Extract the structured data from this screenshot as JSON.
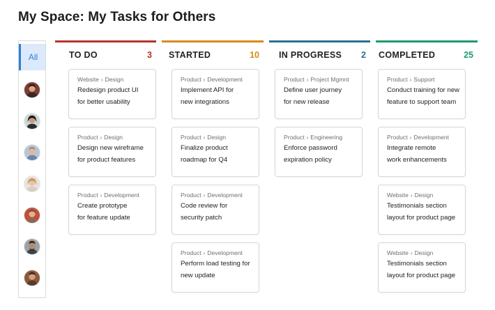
{
  "page_title": "My Space: My Tasks for Others",
  "filter": {
    "all_label": "All"
  },
  "colors": {
    "todo": "#b8322a",
    "started": "#d98a1c",
    "in_progress": "#2a6f92",
    "completed": "#1f9a6b",
    "accent": "#2f80d7"
  },
  "avatars": [
    "person-1-avatar",
    "person-2-avatar",
    "person-3-avatar",
    "person-4-avatar",
    "person-5-avatar",
    "person-6-avatar",
    "person-7-avatar"
  ],
  "columns": [
    {
      "title": "TO DO",
      "count": "3",
      "cards": [
        {
          "category": "Website",
          "subcategory": "Design",
          "line1": "Redesign product UI",
          "line2": "for better usability"
        },
        {
          "category": "Product",
          "subcategory": "Design",
          "line1": "Design new wireframe",
          "line2": "for product features"
        },
        {
          "category": "Product",
          "subcategory": "Development",
          "line1": "Create prototype",
          "line2": "for feature update"
        }
      ]
    },
    {
      "title": "STARTED",
      "count": "10",
      "cards": [
        {
          "category": "Product",
          "subcategory": "Development",
          "line1": "Implement API for",
          "line2": "new integrations"
        },
        {
          "category": "Product",
          "subcategory": "Design",
          "line1": "Finalize product",
          "line2": "roadmap for Q4"
        },
        {
          "category": "Product",
          "subcategory": "Development",
          "line1": "Code review for",
          "line2": "security patch"
        },
        {
          "category": "Product",
          "subcategory": "Development",
          "line1": "Perform load testing for",
          "line2": "new update"
        }
      ]
    },
    {
      "title": "IN PROGRESS",
      "count": "2",
      "cards": [
        {
          "category": "Product",
          "subcategory": "Project Mgmnt",
          "line1": "Define user journey",
          "line2": "for new release"
        },
        {
          "category": "Product",
          "subcategory": "Engineering",
          "line1": "Enforce password",
          "line2": "expiration policy"
        }
      ]
    },
    {
      "title": "COMPLETED",
      "count": "25",
      "cards": [
        {
          "category": "Product",
          "subcategory": "Support",
          "line1": "Conduct training for new",
          "line2": "feature to support team"
        },
        {
          "category": "Product",
          "subcategory": "Development",
          "line1": "Integrate remote",
          "line2": "work enhancements"
        },
        {
          "category": "Website",
          "subcategory": "Design",
          "line1": "Testimonials section",
          "line2": "layout for product page"
        },
        {
          "category": "Website",
          "subcategory": "Design",
          "line1": "Testimonials section",
          "line2": "layout for product page"
        }
      ]
    }
  ]
}
